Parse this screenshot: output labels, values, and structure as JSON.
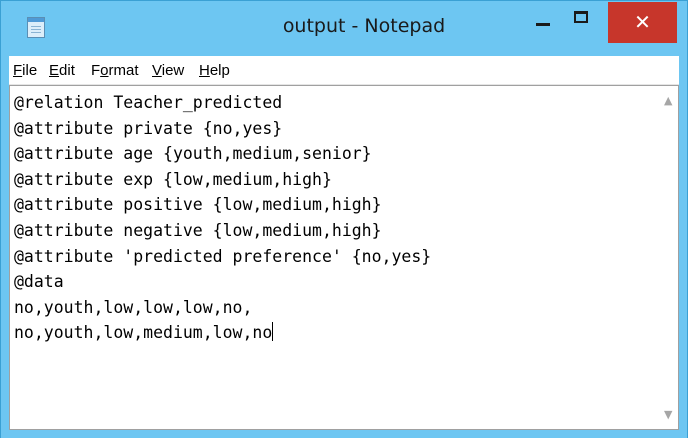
{
  "window": {
    "title": "output - Notepad",
    "accent_color": "#6dc6f2",
    "close_color": "#c7362b"
  },
  "controls": {
    "minimize_glyph": "–",
    "maximize_glyph": "□",
    "close_glyph": "✕"
  },
  "menu": {
    "items": [
      {
        "mnemonic": "F",
        "rest": "ile"
      },
      {
        "mnemonic": "E",
        "rest": "dit"
      },
      {
        "prefix": "F",
        "mnemonic": "o",
        "rest": "rmat"
      },
      {
        "mnemonic": "V",
        "rest": "iew"
      },
      {
        "mnemonic": "H",
        "rest": "elp"
      }
    ]
  },
  "document": {
    "lines": [
      "@relation Teacher_predicted",
      "@attribute private {no,yes}",
      "@attribute age {youth,medium,senior}",
      "@attribute exp {low,medium,high}",
      "@attribute positive {low,medium,high}",
      "@attribute negative {low,medium,high}",
      "@attribute 'predicted preference' {no,yes}",
      "@data",
      "no,youth,low,low,low,no,",
      "no,youth,low,medium,low,no"
    ]
  },
  "scrollbar": {
    "up_icon": "up-arrow",
    "down_icon": "down-arrow"
  }
}
